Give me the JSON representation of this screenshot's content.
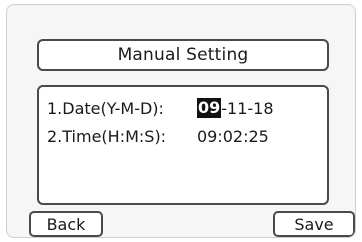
{
  "screen": {
    "title": "Manual Setting",
    "fields": [
      {
        "label": "1.Date(Y-M-D):",
        "active_segment": "09",
        "rest": "-11-18"
      },
      {
        "label": "2.Time(H:M:S):",
        "value": "09:02:25"
      }
    ]
  },
  "softkeys": {
    "back_label": "Back",
    "save_label": "Save"
  }
}
